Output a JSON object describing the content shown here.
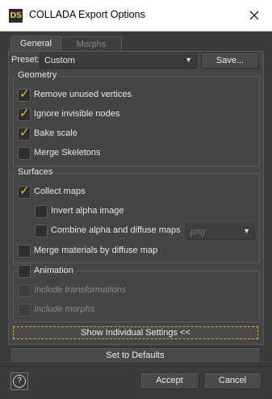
{
  "window": {
    "logo": "DS",
    "title": "COLLADA Export Options"
  },
  "tabs": [
    {
      "label": "General",
      "active": true
    },
    {
      "label": "Morphs",
      "active": false
    }
  ],
  "preset": {
    "label": "Preset:",
    "value": "Custom",
    "save_label": "Save..."
  },
  "geometry": {
    "title": "Geometry",
    "items": [
      {
        "label": "Remove unused vertices",
        "checked": true
      },
      {
        "label": "Ignore invisible nodes",
        "checked": true
      },
      {
        "label": "Bake scale",
        "checked": true
      },
      {
        "label": "Merge Skeletons",
        "checked": false
      }
    ]
  },
  "surfaces": {
    "title": "Surfaces",
    "collect_maps": {
      "label": "Collect maps",
      "checked": true
    },
    "invert_alpha": {
      "label": "Invert alpha image",
      "checked": false
    },
    "combine_alpha": {
      "label": "Combine alpha and diffuse maps",
      "checked": false
    },
    "format_value": "png",
    "merge_materials": {
      "label": "Merge materials by diffuse map",
      "checked": false
    }
  },
  "animation": {
    "label": "Animation",
    "checked": false,
    "include_transformations": {
      "label": "Include transformations",
      "checked": false
    },
    "include_morphs": {
      "label": "Include morphs",
      "checked": false
    }
  },
  "buttons": {
    "show_individual": "Show Individual Settings <<",
    "set_defaults": "Set to Defaults",
    "accept": "Accept",
    "cancel": "Cancel",
    "help": "?"
  },
  "colors": {
    "accent": "#f0b429",
    "panel": "#454545",
    "window_bg": "#3b3b3b",
    "focus_outline": "#e0b000"
  },
  "icons": {
    "close": "close-icon",
    "combo_arrow": "triangle-down-icon",
    "check": "checkmark-icon",
    "help": "help-icon"
  }
}
